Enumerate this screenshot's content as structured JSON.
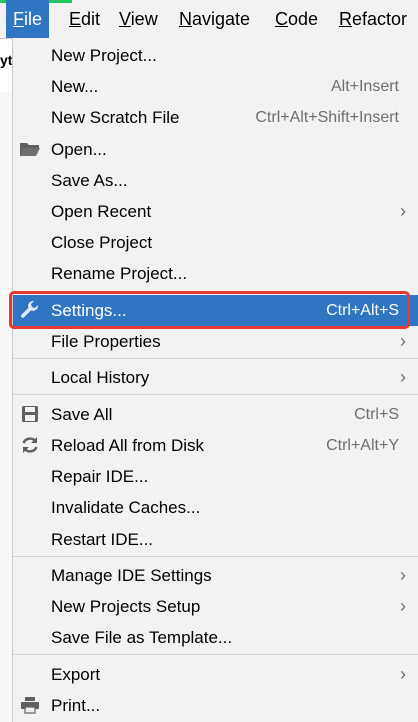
{
  "menubar": {
    "items": [
      {
        "label": "File",
        "mnemonic": "F",
        "rest": "ile"
      },
      {
        "label": "Edit",
        "mnemonic": "E",
        "rest": "dit"
      },
      {
        "label": "View",
        "mnemonic": "V",
        "rest": "iew"
      },
      {
        "label": "Navigate",
        "mnemonic": "N",
        "rest": "avigate"
      },
      {
        "label": "Code",
        "mnemonic": "C",
        "rest": "ode"
      },
      {
        "label": "Refactor",
        "mnemonic": "R",
        "rest": "efactor"
      }
    ],
    "active_color": "#2f75c2"
  },
  "background_peek": {
    "text": "yt"
  },
  "file_menu": {
    "items": [
      {
        "label": "New Project..."
      },
      {
        "label": "New...",
        "shortcut": "Alt+Insert"
      },
      {
        "label": "New Scratch File",
        "shortcut": "Ctrl+Alt+Shift+Insert"
      },
      {
        "label": "Open...",
        "icon": "folder-icon"
      },
      {
        "label": "Save As..."
      },
      {
        "label": "Open Recent",
        "submenu": true
      },
      {
        "label": "Close Project"
      },
      {
        "label": "Rename Project..."
      },
      {
        "label": "Settings...",
        "shortcut": "Ctrl+Alt+S",
        "icon": "wrench-icon",
        "highlighted": true
      },
      {
        "label": "File Properties",
        "submenu": true
      },
      {
        "label": "Local History",
        "submenu": true
      },
      {
        "label": "Save All",
        "shortcut": "Ctrl+S",
        "icon": "save-icon"
      },
      {
        "label": "Reload All from Disk",
        "shortcut": "Ctrl+Alt+Y",
        "icon": "reload-icon"
      },
      {
        "label": "Repair IDE..."
      },
      {
        "label": "Invalidate Caches..."
      },
      {
        "label": "Restart IDE..."
      },
      {
        "label": "Manage IDE Settings",
        "submenu": true
      },
      {
        "label": "New Projects Setup",
        "submenu": true
      },
      {
        "label": "Save File as Template..."
      },
      {
        "label": "Export",
        "submenu": true
      },
      {
        "label": "Print...",
        "icon": "printer-icon"
      }
    ],
    "submenu_arrow": "›",
    "highlight_color": "#2f75c2",
    "highlight_outline_color": "#e53935"
  }
}
